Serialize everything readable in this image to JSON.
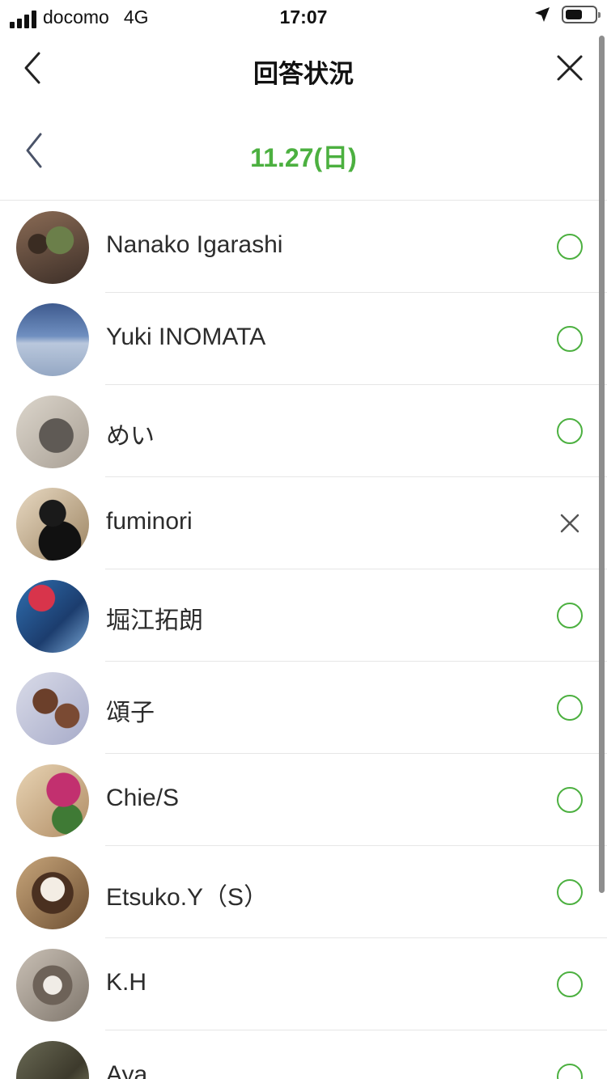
{
  "status_bar": {
    "carrier": "docomo",
    "network": "4G",
    "time": "17:07",
    "battery_level": 0.6
  },
  "header": {
    "title": "回答状況"
  },
  "date_nav": {
    "label": "11.27(日)",
    "accent_color": "#4cb040"
  },
  "responses": [
    {
      "name": "Nanako Igarashi",
      "status": "attend"
    },
    {
      "name": "Yuki INOMATA",
      "status": "attend"
    },
    {
      "name": "めい",
      "status": "attend"
    },
    {
      "name": "fuminori",
      "status": "absent"
    },
    {
      "name": "堀江拓朗",
      "status": "attend"
    },
    {
      "name": "頌子",
      "status": "attend"
    },
    {
      "name": "Chie/S",
      "status": "attend"
    },
    {
      "name": "Etsuko.Y（S）",
      "status": "attend"
    },
    {
      "name": "K.H",
      "status": "attend"
    },
    {
      "name": "Aya",
      "status": "attend"
    }
  ],
  "icons": {
    "back": "chevron-left-icon",
    "close": "close-icon",
    "attend": "circle-icon",
    "absent": "cross-icon"
  }
}
